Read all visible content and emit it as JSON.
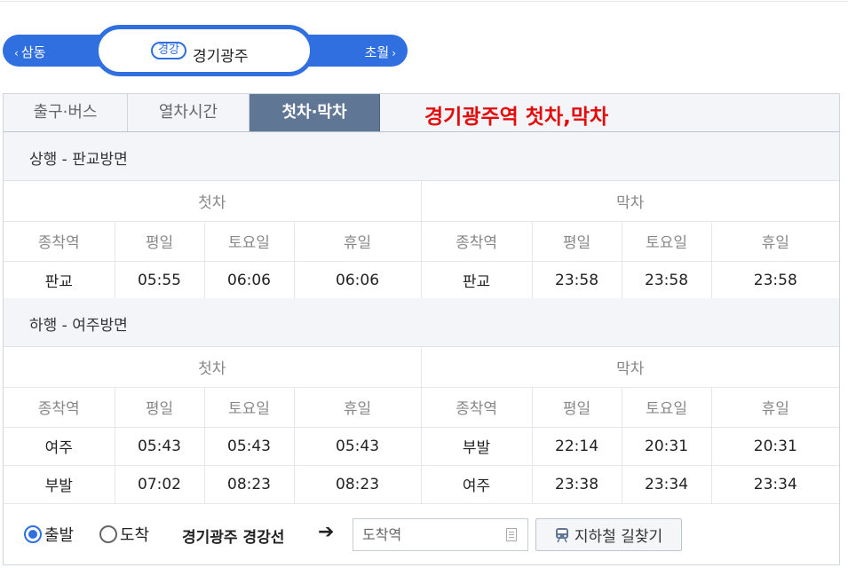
{
  "station_bar": {
    "prev_station": "삼동",
    "next_station": "초월",
    "line_badge": "경강",
    "station_name": "경기광주"
  },
  "tabs": [
    {
      "label": "출구·버스",
      "active": false
    },
    {
      "label": "열차시간",
      "active": false
    },
    {
      "label": "첫차·막차",
      "active": true
    }
  ],
  "page_title": "경기광주역 첫차,막차",
  "headers": {
    "first": "첫차",
    "last": "막차",
    "terminal": "종착역",
    "weekday": "평일",
    "saturday": "토요일",
    "holiday": "휴일"
  },
  "sections": [
    {
      "title": "상행 - 판교방면",
      "rows": [
        {
          "first_terminal": "판교",
          "first_weekday": "05:55",
          "first_saturday": "06:06",
          "first_holiday": "06:06",
          "last_terminal": "판교",
          "last_weekday": "23:58",
          "last_saturday": "23:58",
          "last_holiday": "23:58"
        }
      ]
    },
    {
      "title": "하행 - 여주방면",
      "rows": [
        {
          "first_terminal": "여주",
          "first_weekday": "05:43",
          "first_saturday": "05:43",
          "first_holiday": "05:43",
          "last_terminal": "부발",
          "last_weekday": "22:14",
          "last_saturday": "20:31",
          "last_holiday": "20:31"
        },
        {
          "first_terminal": "부발",
          "first_weekday": "07:02",
          "first_saturday": "08:23",
          "first_holiday": "08:23",
          "last_terminal": "여주",
          "last_weekday": "23:38",
          "last_saturday": "23:34",
          "last_holiday": "23:34"
        }
      ]
    }
  ],
  "route_finder": {
    "departure_label": "출발",
    "arrival_label": "도착",
    "selected": "departure",
    "origin_label": "경기광주 경강선",
    "arrow": "➔",
    "destination_placeholder": "도착역",
    "button_label": "지하철 길찾기"
  },
  "colors": {
    "accent_blue": "#2f6fe0",
    "active_tab": "#5f7694",
    "title_red": "#e30b0b"
  }
}
